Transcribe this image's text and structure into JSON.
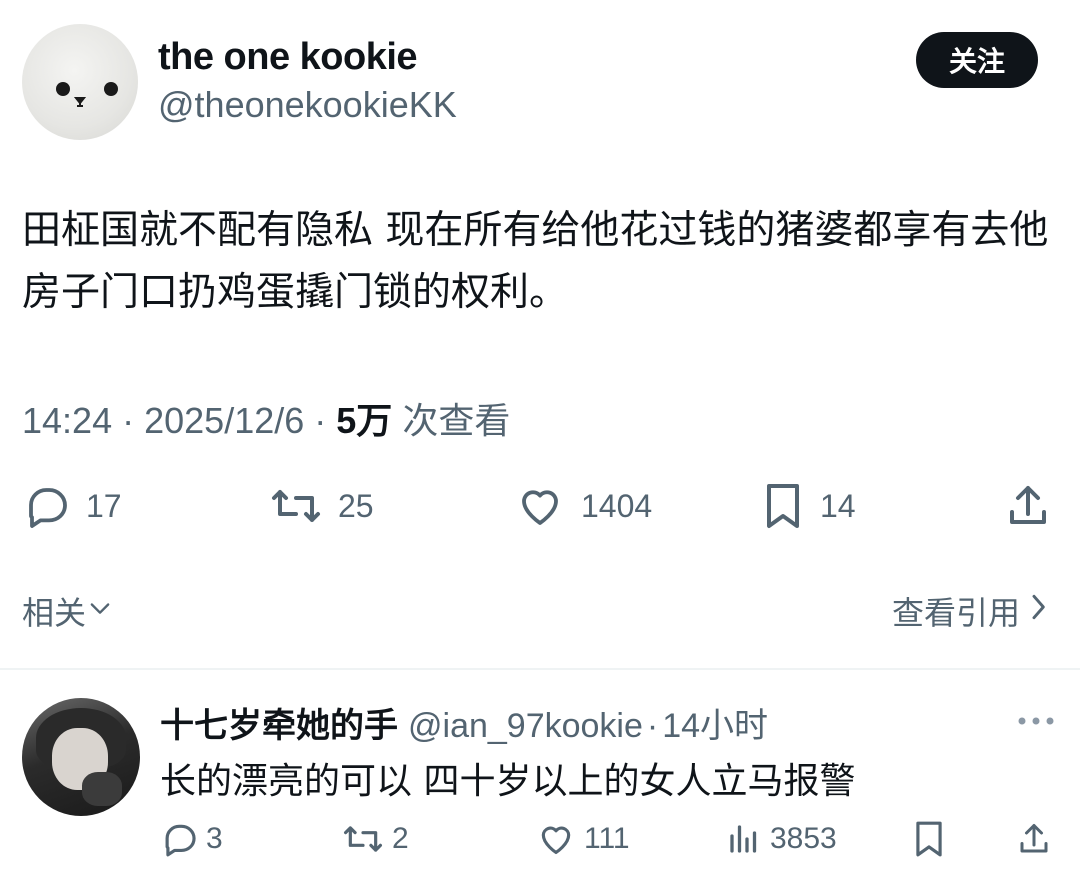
{
  "post": {
    "display_name": "the one kookie",
    "handle": "@theonekookieKK",
    "follow_label": "关注",
    "text": "田柾国就不配有隐私 现在所有给他花过钱的猪婆都享有去他房子门口扔鸡蛋撬门锁的权利。",
    "time": "14:24",
    "date": "2025/12/6",
    "views": "5万",
    "views_suffix": "次查看",
    "stats": {
      "replies": "17",
      "retweets": "25",
      "likes": "1404",
      "bookmarks": "14"
    },
    "related_label": "相关",
    "view_quotes_label": "查看引用"
  },
  "reply": {
    "display_name": "十七岁牵她的手",
    "handle": "@ian_97kookie",
    "time": "14小时",
    "text": "长的漂亮的可以 四十岁以上的女人立马报警",
    "stats": {
      "replies": "3",
      "retweets": "2",
      "likes": "111",
      "views": "3853"
    }
  },
  "icons": {
    "reply": "reply-icon",
    "retweet": "retweet-icon",
    "like": "heart-icon",
    "bookmark": "bookmark-icon",
    "share": "share-icon",
    "views": "views-icon",
    "more": "more-icon",
    "chevron_down": "chevron-down-icon",
    "chevron_right": "chevron-right-icon"
  },
  "colors": {
    "text_primary": "#0f1419",
    "text_secondary": "#536471",
    "button_bg": "#0f1419",
    "divider": "#eff3f4"
  }
}
